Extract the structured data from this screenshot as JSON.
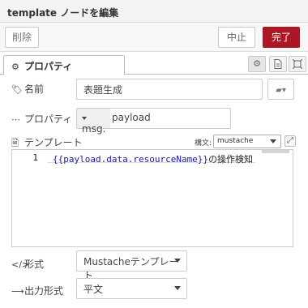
{
  "window": {
    "title": "template ノードを編集"
  },
  "toolbar": {
    "delete_label": "削除",
    "cancel_label": "中止",
    "done_label": "完了"
  },
  "tabs": {
    "properties_label": "プロパティ",
    "icons": [
      "gear-icon",
      "document-icon",
      "frame-icon"
    ]
  },
  "form": {
    "name": {
      "label": "名前",
      "value": "表題生成"
    },
    "property": {
      "label": "プロパティ",
      "type": "msg.",
      "value": "payload"
    },
    "template": {
      "label": "テンプレート",
      "syntax_label": "構文:",
      "syntax_value": "mustache",
      "line_numbers": [
        "1"
      ],
      "code": {
        "mustache": "{{payload.data.resourceName}}",
        "text": "の操作検知"
      }
    },
    "format": {
      "label": "形式",
      "value": "Mustacheテンプレート"
    },
    "output": {
      "label": "出力形式",
      "value": "平文"
    }
  },
  "colors": {
    "accent": "#ad1625",
    "border": "#cccccc"
  }
}
